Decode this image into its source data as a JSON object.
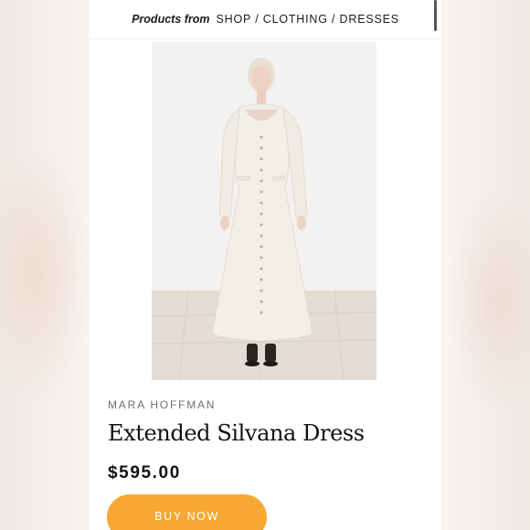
{
  "breadcrumb": {
    "lead": "Products from",
    "path": "SHOP / CLOTHING / DRESSES"
  },
  "product": {
    "brand": "MARA HOFFMAN",
    "name": "Extended Silvana Dress",
    "price": "$595.00",
    "buy_label": "BUY NOW",
    "image_alt": "model wearing white long-sleeve button-front maxi dress"
  },
  "colors": {
    "accent": "#f7a733",
    "text": "#111111",
    "muted": "#6f6f6f"
  }
}
